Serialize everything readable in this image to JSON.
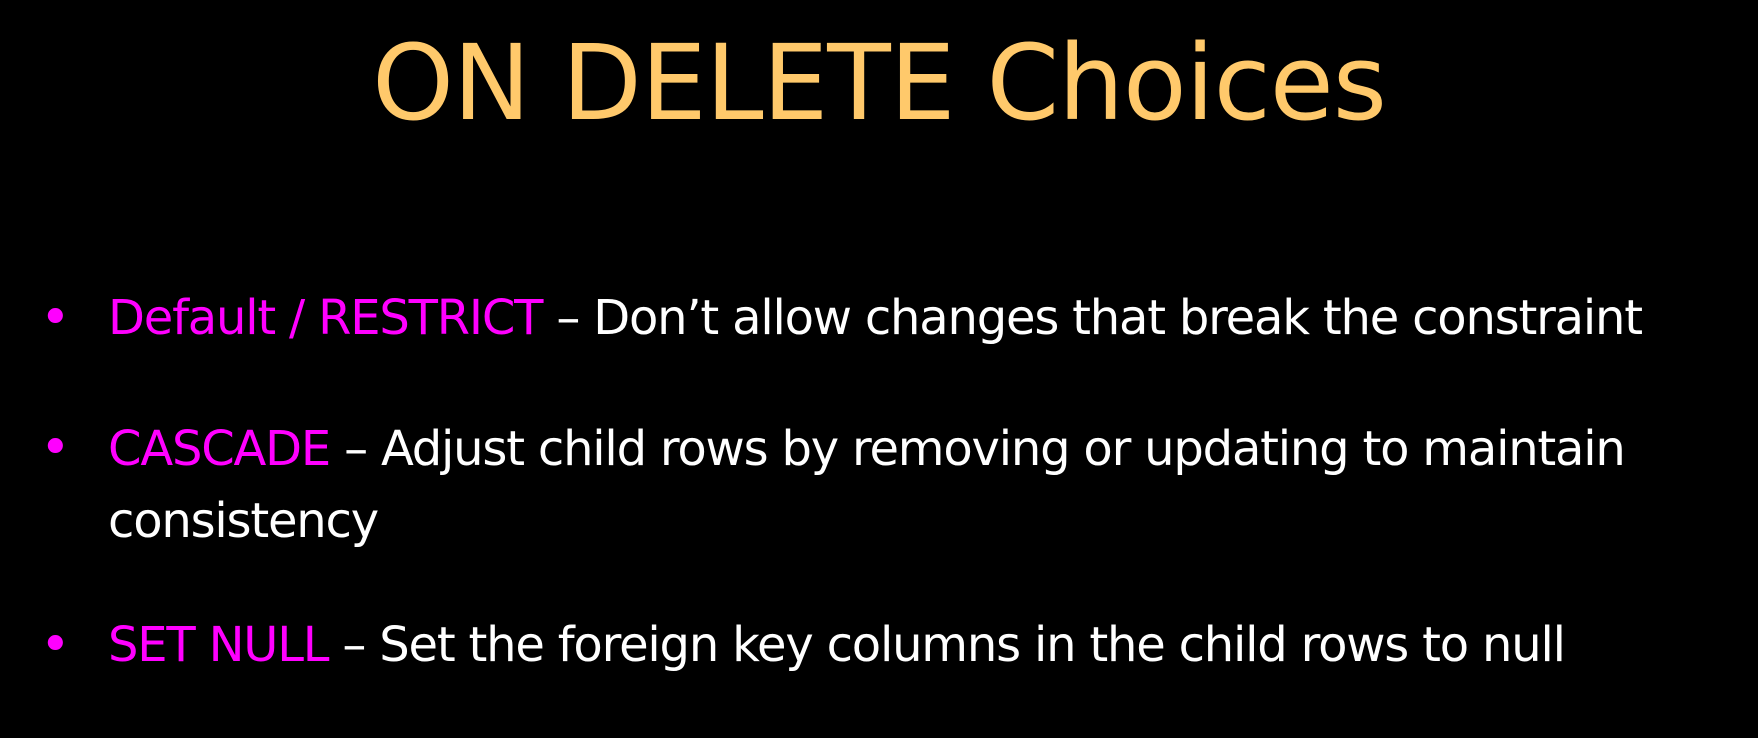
{
  "slide": {
    "title": "ON DELETE Choices",
    "bullet_symbol": "•",
    "colors": {
      "background": "#000000",
      "title": "#FFC96B",
      "term": "#FF00FF",
      "body": "#FFFFFF"
    },
    "bullets": [
      {
        "term": "Default / RESTRICT",
        "description": " – Don’t allow changes that break the constraint"
      },
      {
        "term": "CASCADE",
        "description": " – Adjust child rows by removing or updating to maintain consistency"
      },
      {
        "term": "SET NULL",
        "description": " – Set the foreign key columns in the child rows to null"
      }
    ]
  }
}
